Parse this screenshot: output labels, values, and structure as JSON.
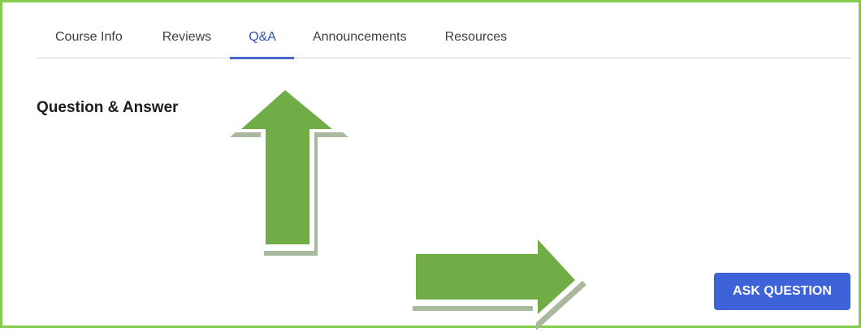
{
  "tabs": [
    {
      "label": "Course Info",
      "active": false
    },
    {
      "label": "Reviews",
      "active": false
    },
    {
      "label": "Q&A",
      "active": true
    },
    {
      "label": "Announcements",
      "active": false
    },
    {
      "label": "Resources",
      "active": false
    }
  ],
  "main": {
    "title": "Question & Answer",
    "ask_button_label": "ASK QUESTION"
  },
  "colors": {
    "frame_border": "#86cc4e",
    "active_tab": "#2d53b8",
    "button_bg": "#3e63d8",
    "arrow_fill": "#70ad47"
  },
  "annotations": [
    {
      "icon": "up-arrow-icon",
      "points_to": "tab-qa"
    },
    {
      "icon": "right-arrow-icon",
      "points_to": "ask-question-button"
    }
  ]
}
